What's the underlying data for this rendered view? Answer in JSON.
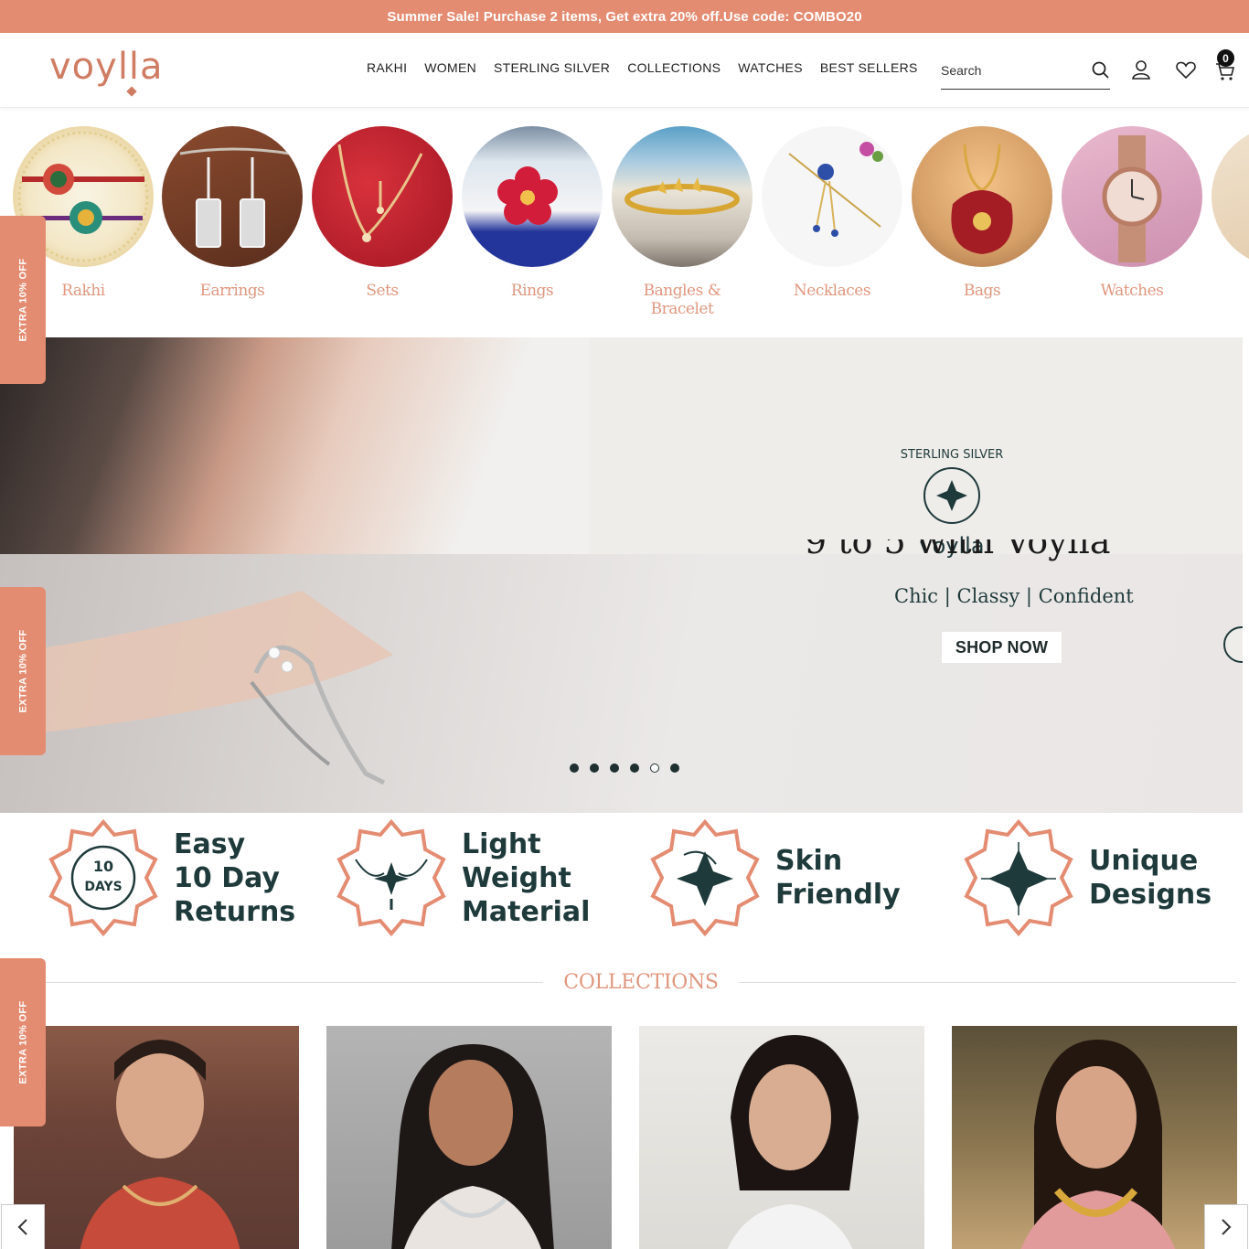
{
  "announcement": "Summer Sale! Purchase 2 items, Get extra 20% off.Use code: COMBO20",
  "brand": "voylla",
  "nav": [
    "RAKHI",
    "WOMEN",
    "STERLING SILVER",
    "COLLECTIONS",
    "WATCHES",
    "BEST SELLERS"
  ],
  "search": {
    "placeholder": "Search"
  },
  "cart_count": "0",
  "side_tab": "EXTRA 10% OFF",
  "categories": [
    "Rakhi",
    "Earrings",
    "Sets",
    "Rings",
    "Bangles & Bracelet",
    "Necklaces",
    "Bags",
    "Watches"
  ],
  "hero": {
    "badge_text": "STERLING SILVER",
    "badge_brand": "voylla",
    "title": "9 to 5 with Voylla",
    "subtitle": "Chic | Classy | Confident",
    "cta": "SHOP NOW",
    "slides": 6,
    "active_slide": 5
  },
  "features": [
    {
      "badge": [
        "10",
        "DAYS"
      ],
      "lines": [
        "Easy",
        "10 Day",
        "Returns"
      ]
    },
    {
      "lines": [
        "Light",
        "Weight",
        "Material"
      ]
    },
    {
      "lines": [
        "Skin",
        "Friendly"
      ]
    },
    {
      "lines": [
        "Unique",
        "Designs"
      ]
    }
  ],
  "collections_title": "COLLECTIONS",
  "colors": {
    "accent": "#e48c72",
    "category_text": "#e0977f",
    "feature_text": "#1f3a3b"
  }
}
